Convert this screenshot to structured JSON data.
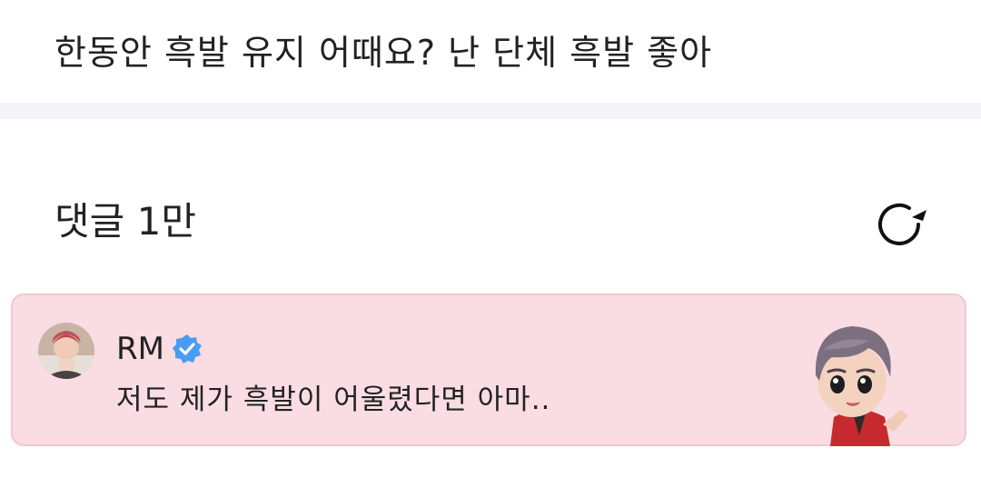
{
  "post": {
    "text": "한동안 흑발 유지 어때요? 난 단체 흑발 좋아"
  },
  "comments": {
    "header_label": "댓글 1만"
  },
  "pinned_comment": {
    "author": "RM",
    "text": "저도 제가 흑발이 어울렸다면 아마..",
    "verified_icon": "verified-badge-icon",
    "background_color": "#fadce3",
    "border_color": "#f1c7d1"
  },
  "icons": {
    "refresh": "refresh-icon",
    "verified_color": "#4a9cf3"
  }
}
